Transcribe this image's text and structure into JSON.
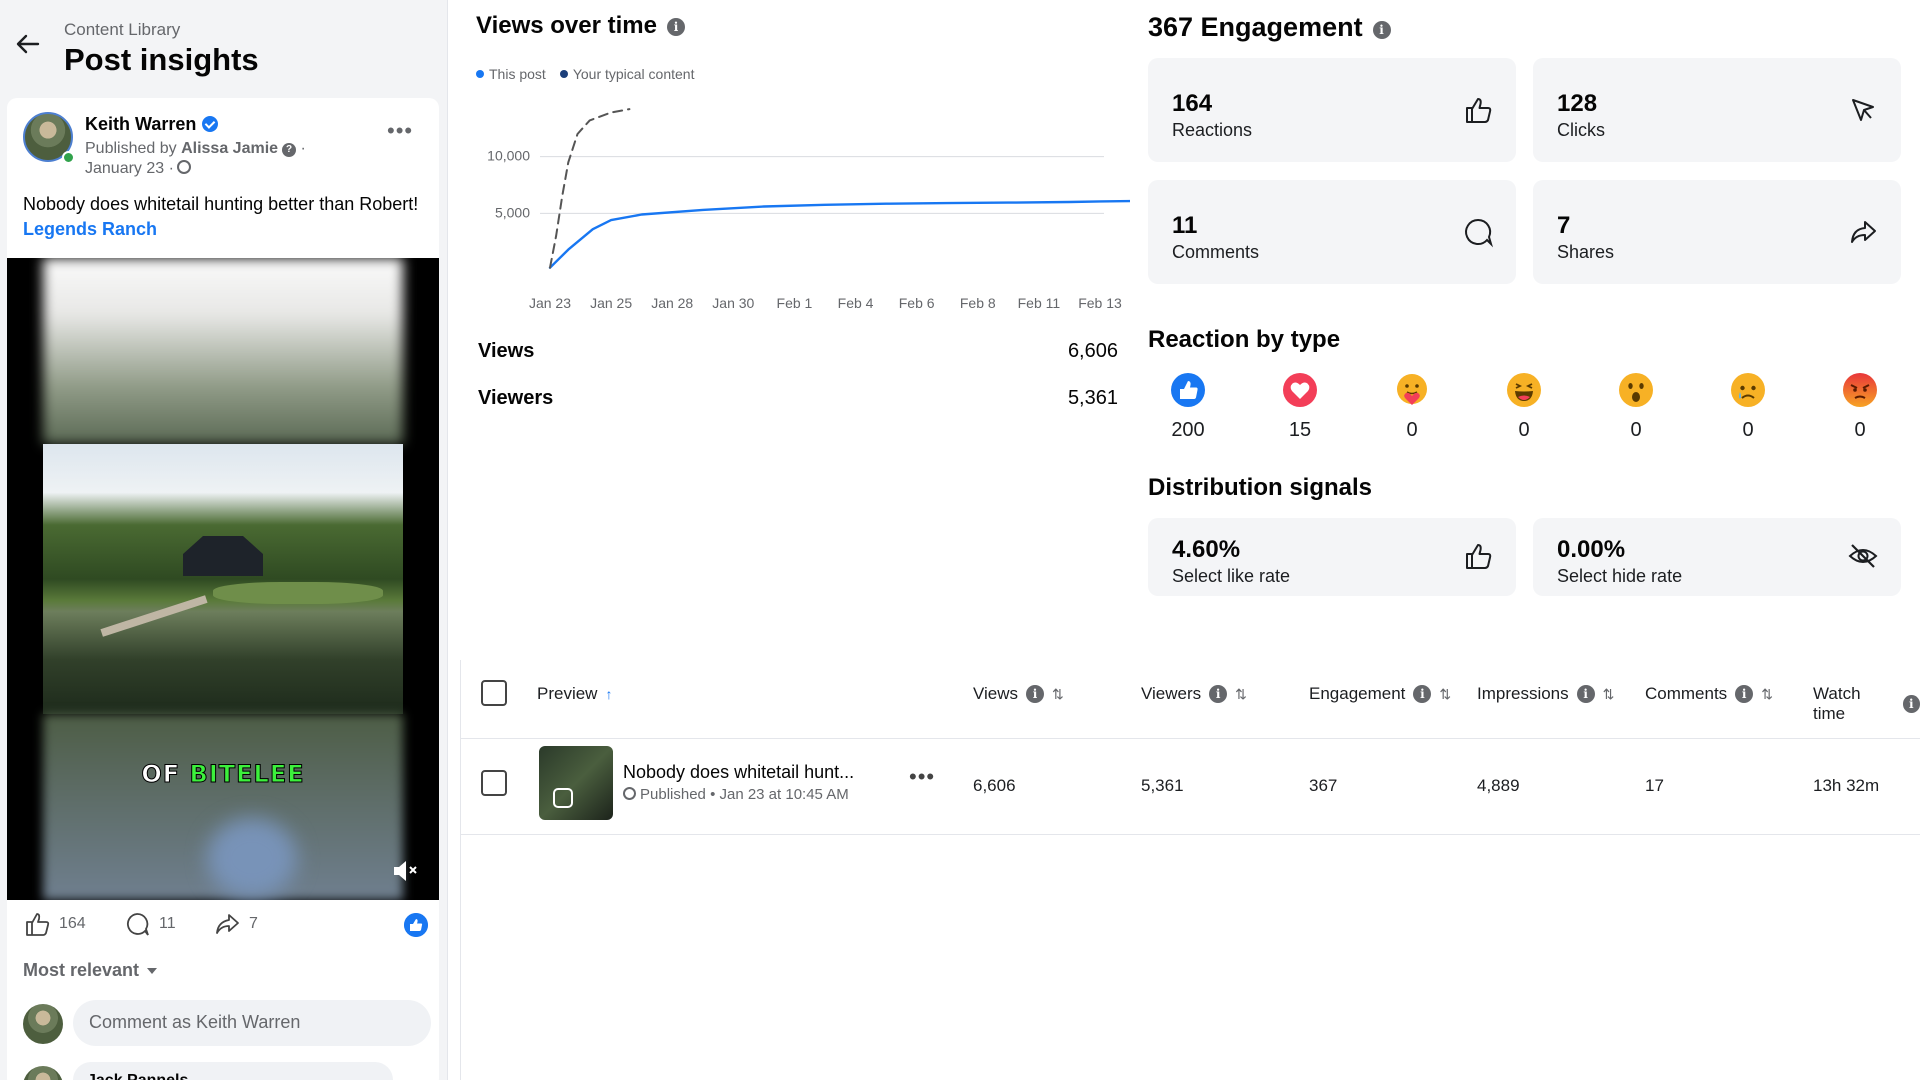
{
  "header": {
    "breadcrumb": "Content Library",
    "title": "Post insights"
  },
  "post": {
    "author": "Keith Warren",
    "published_by_prefix": "Published by",
    "published_by_name": "Alissa Jamie",
    "date": "January 23 ·",
    "text": "Nobody does whitetail hunting better than Robert!",
    "link_text": "Legends Ranch",
    "video_caption_white": "OF",
    "video_caption_green": "BITELEE",
    "likes": "164",
    "comments": "11",
    "shares": "7",
    "sort_label": "Most relevant",
    "comment_placeholder": "Comment as Keith Warren",
    "next_commenter": "Jack Pannels"
  },
  "views_over_time": {
    "title": "Views over time",
    "legend": [
      "This post",
      "Your typical content"
    ],
    "metrics": [
      {
        "label": "Views",
        "value": "6,606"
      },
      {
        "label": "Viewers",
        "value": "5,361"
      }
    ]
  },
  "chart_data": {
    "type": "line",
    "x": [
      "Jan 23",
      "Jan 25",
      "Jan 28",
      "Jan 30",
      "Feb 1",
      "Feb 4",
      "Feb 6",
      "Feb 8",
      "Feb 11",
      "Feb 13"
    ],
    "y_ticks": [
      {
        "value": 10000,
        "label": "10,000"
      },
      {
        "value": 5000,
        "label": "5,000"
      }
    ],
    "ylim": [
      0,
      15000
    ],
    "series": [
      {
        "name": "This post",
        "color": "#1877f2",
        "style": "solid",
        "points": [
          [
            0,
            200
          ],
          [
            0.3,
            1800
          ],
          [
            0.7,
            3600
          ],
          [
            1,
            4400
          ],
          [
            1.5,
            4900
          ],
          [
            2.5,
            5300
          ],
          [
            3.5,
            5600
          ],
          [
            4.5,
            5750
          ],
          [
            5.5,
            5850
          ],
          [
            6.5,
            5900
          ],
          [
            7.5,
            5950
          ],
          [
            8.5,
            6000
          ],
          [
            9,
            6050
          ],
          [
            9.8,
            6100
          ]
        ]
      },
      {
        "name": "Your typical content",
        "color": "#555555",
        "style": "dashed",
        "points": [
          [
            0,
            200
          ],
          [
            0.1,
            3000
          ],
          [
            0.2,
            6500
          ],
          [
            0.3,
            9500
          ],
          [
            0.45,
            12000
          ],
          [
            0.65,
            13200
          ],
          [
            1,
            13900
          ],
          [
            1.3,
            14200
          ]
        ]
      }
    ]
  },
  "engagement": {
    "title": "367 Engagement",
    "tiles": [
      {
        "value": "164",
        "label": "Reactions",
        "icon": "thumbs-up-icon"
      },
      {
        "value": "128",
        "label": "Clicks",
        "icon": "cursor-icon"
      },
      {
        "value": "11",
        "label": "Comments",
        "icon": "comment-icon"
      },
      {
        "value": "7",
        "label": "Shares",
        "icon": "share-icon"
      }
    ]
  },
  "reactions": {
    "title": "Reaction by type",
    "items": [
      {
        "type": "like",
        "count": "200",
        "color": "#1877f2"
      },
      {
        "type": "love",
        "count": "15",
        "color": "#f33e58"
      },
      {
        "type": "care",
        "count": "0",
        "color": "#f7b125"
      },
      {
        "type": "haha",
        "count": "0",
        "color": "#f7b125"
      },
      {
        "type": "wow",
        "count": "0",
        "color": "#f7b125"
      },
      {
        "type": "sad",
        "count": "0",
        "color": "#f7b125"
      },
      {
        "type": "angry",
        "count": "0",
        "color": "#e9710f"
      }
    ]
  },
  "distribution": {
    "title": "Distribution signals",
    "tiles": [
      {
        "value": "4.60%",
        "label": "Select like rate",
        "icon": "thumbs-up-icon"
      },
      {
        "value": "0.00%",
        "label": "Select hide rate",
        "icon": "eye-slash-icon"
      }
    ]
  },
  "table": {
    "columns": [
      "Preview",
      "Views",
      "Viewers",
      "Engagement",
      "Impressions",
      "Comments",
      "Watch time"
    ],
    "row": {
      "title": "Nobody does whitetail hunt...",
      "status": "Published",
      "date": "• Jan 23 at 10:45 AM",
      "views": "6,606",
      "viewers": "5,361",
      "engagement": "367",
      "impressions": "4,889",
      "comments": "17",
      "watch_time": "13h 32m"
    }
  },
  "colors": {
    "accent": "#1877f2",
    "tile_bg": "#f4f5f7",
    "muted_text": "#65676b"
  }
}
